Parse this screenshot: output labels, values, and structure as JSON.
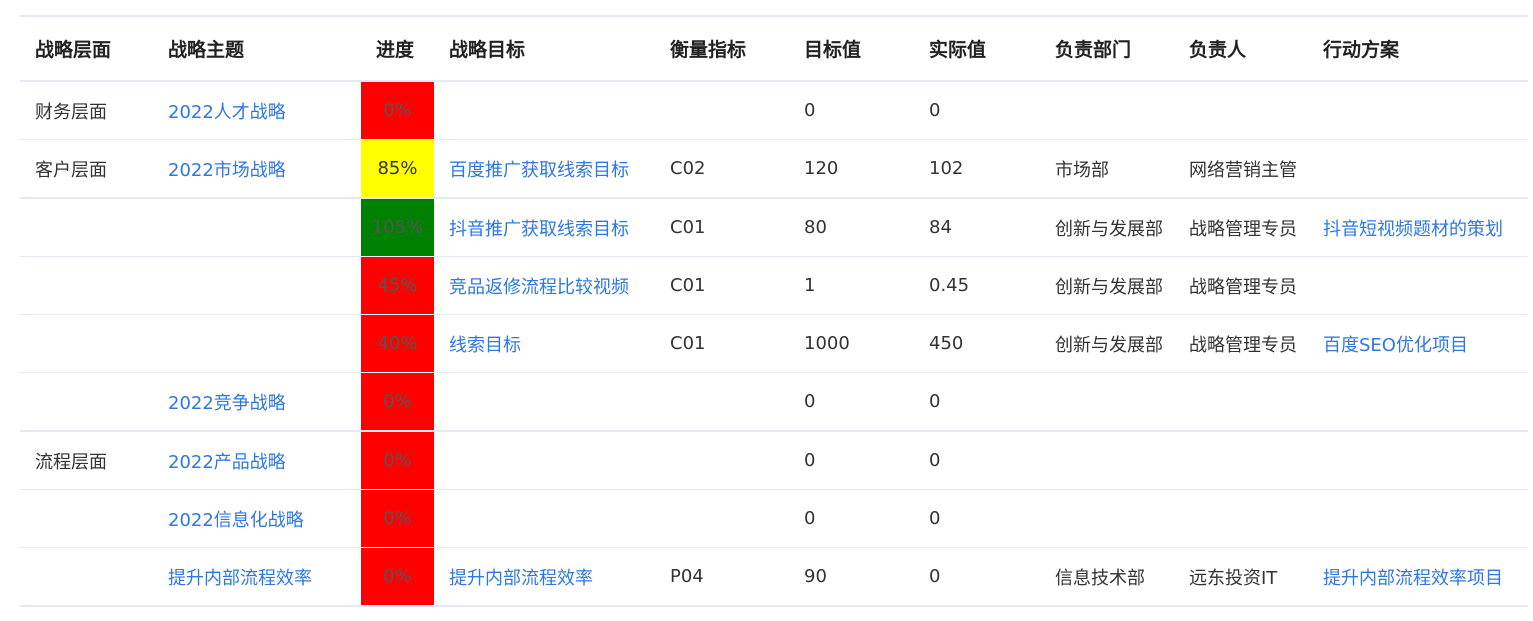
{
  "columns": [
    "战略层面",
    "战略主题",
    "进度",
    "战略目标",
    "衡量指标",
    "目标值",
    "实际值",
    "负责部门",
    "负责人",
    "行动方案"
  ],
  "status_colors": {
    "red": "#ff0000",
    "yellow": "#ffff00",
    "green": "#008000"
  },
  "rows": [
    {
      "level": "财务层面",
      "theme": "2022人才战略",
      "progress": "0%",
      "progress_color": "#ff0000",
      "goal": "",
      "metric": "",
      "target": "0",
      "actual": "0",
      "department": "",
      "owner": "",
      "action": ""
    },
    {
      "level": "客户层面",
      "theme": "2022市场战略",
      "progress": "85%",
      "progress_color": "#ffff00",
      "goal": "百度推广获取线索目标",
      "metric": "C02",
      "target": "120",
      "actual": "102",
      "department": "市场部",
      "owner": "网络营销主管",
      "action": ""
    },
    {
      "level": "",
      "theme": "",
      "progress": "105%",
      "progress_color": "#008000",
      "goal": "抖音推广获取线索目标",
      "metric": "C01",
      "target": "80",
      "actual": "84",
      "department": "创新与发展部",
      "owner": "战略管理专员",
      "action": "抖音短视频题材的策划"
    },
    {
      "level": "",
      "theme": "",
      "progress": "45%",
      "progress_color": "#ff0000",
      "goal": "竞品返修流程比较视频",
      "metric": "C01",
      "target": "1",
      "actual": "0.45",
      "department": "创新与发展部",
      "owner": "战略管理专员",
      "action": ""
    },
    {
      "level": "",
      "theme": "",
      "progress": "40%",
      "progress_color": "#ff0000",
      "goal": "线索目标",
      "metric": "C01",
      "target": "1000",
      "actual": "450",
      "department": "创新与发展部",
      "owner": "战略管理专员",
      "action": "百度SEO优化项目"
    },
    {
      "level": "",
      "theme": "2022竞争战略",
      "progress": "0%",
      "progress_color": "#ff0000",
      "goal": "",
      "metric": "",
      "target": "0",
      "actual": "0",
      "department": "",
      "owner": "",
      "action": ""
    },
    {
      "level": "流程层面",
      "theme": "2022产品战略",
      "progress": "0%",
      "progress_color": "#ff0000",
      "goal": "",
      "metric": "",
      "target": "0",
      "actual": "0",
      "department": "",
      "owner": "",
      "action": ""
    },
    {
      "level": "",
      "theme": "2022信息化战略",
      "progress": "0%",
      "progress_color": "#ff0000",
      "goal": "",
      "metric": "",
      "target": "0",
      "actual": "0",
      "department": "",
      "owner": "",
      "action": ""
    },
    {
      "level": "",
      "theme": "提升内部流程效率",
      "progress": "0%",
      "progress_color": "#ff0000",
      "goal": "提升内部流程效率",
      "metric": "P04",
      "target": "90",
      "actual": "0",
      "department": "信息技术部",
      "owner": "远东投资IT",
      "action": "提升内部流程效率项目"
    }
  ]
}
